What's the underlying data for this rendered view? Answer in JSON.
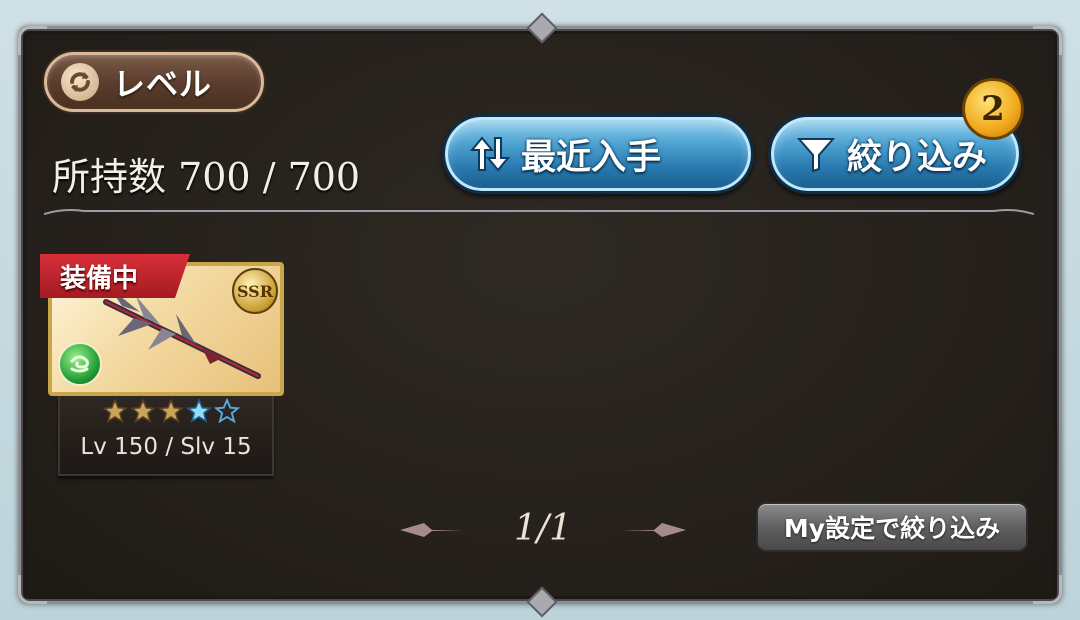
{
  "sort": {
    "label": "レベル",
    "icon": "refresh-icon"
  },
  "inventory": {
    "label": "所持数",
    "count": "700",
    "max": "700",
    "text": "所持数 700 / 700"
  },
  "buttons": {
    "recent": {
      "label": "最近入手",
      "icon": "sort-arrows-icon"
    },
    "filter": {
      "label": "絞り込み",
      "icon": "funnel-icon",
      "badge": "2"
    },
    "my_filter": {
      "label": "My設定で絞り込み"
    }
  },
  "items": [
    {
      "equipped_label": "装備中",
      "rarity": "SSR",
      "element": "wind",
      "element_icon": "wind-element-icon",
      "stars": {
        "filled": 3,
        "blue": 1,
        "empty": 1
      },
      "level_text": "Lv 150 / Slv 15"
    }
  ],
  "pagination": {
    "current": 1,
    "total": 1,
    "text": "1/1"
  },
  "colors": {
    "panel_bg": "#26211c",
    "blue_button": "#2b7db3",
    "equipped_ribbon": "#c7262f",
    "badge_gold": "#f0a81a"
  }
}
